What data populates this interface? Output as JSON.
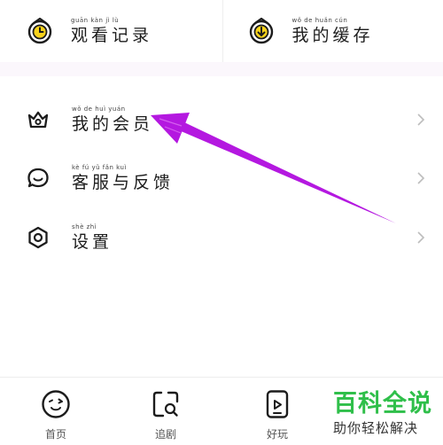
{
  "shortcuts": [
    {
      "label": "观看记录",
      "pinyin": "guān kàn jì lù",
      "icon": "clock-icon"
    },
    {
      "label": "我的缓存",
      "pinyin": "wǒ de huǎn cún",
      "icon": "download-icon"
    }
  ],
  "menu": [
    {
      "label": "我的会员",
      "pinyin": "wǒ de huì yuán",
      "icon": "crown-icon"
    },
    {
      "label": "客服与反馈",
      "pinyin": "kè fú yǔ fǎn kuì",
      "icon": "chat-icon"
    },
    {
      "label": "设置",
      "pinyin": "shè zhì",
      "icon": "gear-icon"
    }
  ],
  "tabs": [
    {
      "label": "首页",
      "icon": "wink-face-icon"
    },
    {
      "label": "追剧",
      "icon": "search-frame-icon"
    },
    {
      "label": "好玩",
      "icon": "play-card-icon"
    }
  ],
  "watermark": {
    "title": "百科全说",
    "subtitle": "助你轻松解决"
  },
  "colors": {
    "accent": "#f7d21c",
    "annotation": "#b418e0",
    "watermark": "#2fbf4a"
  }
}
